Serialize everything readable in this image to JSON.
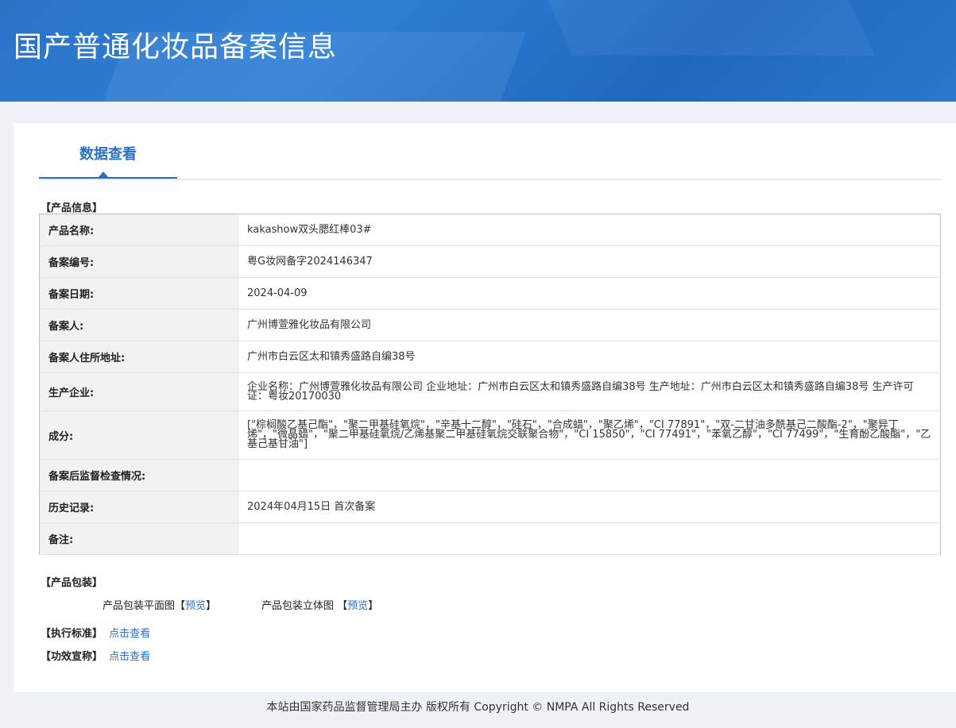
{
  "header": {
    "title": "国产普通化妆品备案信息"
  },
  "tabs": [
    {
      "label": "数据查看"
    }
  ],
  "product_section_title": "【产品信息】",
  "rows": [
    {
      "label": "产品名称:",
      "value": "kakashow双头腮红棒03#"
    },
    {
      "label": "备案编号:",
      "value": "粤G妆网备字2024146347"
    },
    {
      "label": "备案日期:",
      "value": "2024-04-09"
    },
    {
      "label": "备案人:",
      "value": "广州博萱雅化妆品有限公司"
    },
    {
      "label": "备案人住所地址:",
      "value": "广州市白云区太和镇秀盛路自编38号"
    },
    {
      "label": "生产企业:",
      "value": "企业名称：广州博萱雅化妆品有限公司 企业地址：广州市白云区太和镇秀盛路自编38号 生产地址：广州市白云区太和镇秀盛路自编38号 生产许可证：粤妆20170030"
    },
    {
      "label": "成分:",
      "value": "[\"棕榈酸乙基己酯\"，\"聚二甲基硅氧烷\"，\"辛基十二醇\"，\"硅石\"，\"合成蜡\"，\"聚乙烯\"，\"CI 77891\"，\"双-二甘油多酰基己二酸酯-2\"，\"聚异丁烯\"，\"微晶蜡\"，\"聚二甲基硅氧烷/乙烯基聚二甲基硅氧烷交联聚合物\"，\"CI 15850\"，\"CI 77491\"，\"苯氧乙醇\"，\"CI 77499\"，\"生育酚乙酸酯\"，\"乙基己基甘油\"]"
    },
    {
      "label": "备案后监督检查情况:",
      "value": ""
    },
    {
      "label": "历史记录:",
      "value": "2024年04月15日 首次备案"
    },
    {
      "label": "备注:",
      "value": ""
    }
  ],
  "packaging": {
    "title": "【产品包装】",
    "flat_label": "产品包装平面图",
    "flat_link": "预览",
    "stereo_label": "产品包装立体图",
    "stereo_link": "预览",
    "bracket_open": "【",
    "bracket_close": "】"
  },
  "standard": {
    "title": "【执行标准】",
    "link": "点击查看"
  },
  "efficacy": {
    "title": "【功效宣称】",
    "link": "点击查看"
  },
  "footer": {
    "text": "本站由国家药品监督管理局主办 版权所有 Copyright © NMPA All Rights Reserved"
  }
}
